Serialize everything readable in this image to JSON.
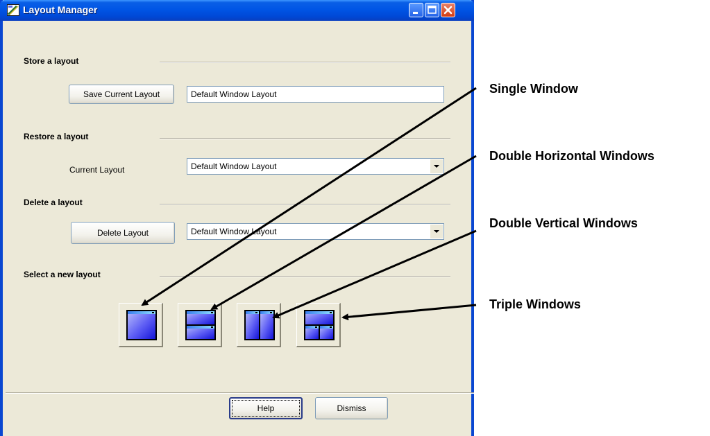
{
  "window": {
    "title": "Layout Manager"
  },
  "store": {
    "heading": "Store a layout",
    "save_button": "Save Current Layout",
    "name_value": "Default Window Layout"
  },
  "restore": {
    "heading": "Restore a layout",
    "label": "Current Layout",
    "selected": "Default Window Layout"
  },
  "delete": {
    "heading": "Delete a layout",
    "button": "Delete Layout",
    "selected": "Default Window Layout"
  },
  "select": {
    "heading": "Select a new layout",
    "options": [
      "single-window",
      "double-horizontal-windows",
      "double-vertical-windows",
      "triple-windows"
    ]
  },
  "footer": {
    "help_button": "Help",
    "dismiss_button": "Dismiss"
  },
  "annotations": {
    "single": "Single Window",
    "double_horizontal": "Double Horizontal Windows",
    "double_vertical": "Double Vertical Windows",
    "triple": "Triple Windows"
  },
  "colors": {
    "titlebar": "#0055e5",
    "window_bg": "#ece9d8",
    "tile_blue": "#3a3af0"
  }
}
